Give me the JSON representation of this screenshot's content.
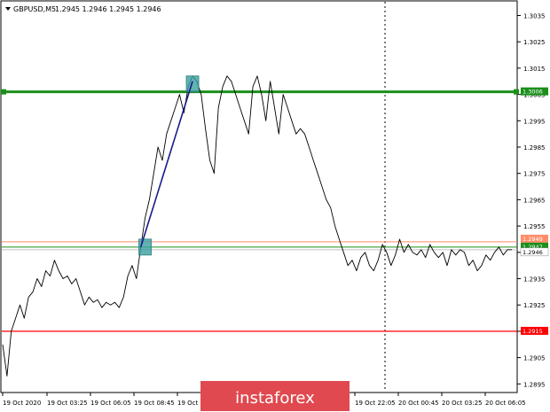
{
  "header": {
    "symbol": "GBPUSD,M5",
    "ohlc": "1.2945 1.2946 1.2945 1.2946"
  },
  "watermark": {
    "text": "instaforex",
    "color": "#e0494f"
  },
  "colors": {
    "price": "#000000",
    "trend": "#1a1a8c",
    "resistance": "#1a8f1a",
    "support": "#ff0000",
    "level_hi": "#ff8c69",
    "level_lo": "#1a8f1a",
    "marker": "#3aa0a0",
    "grid": "#000000"
  },
  "chart_data": {
    "type": "line",
    "title": "",
    "ylim": [
      1.2885,
      1.3045
    ],
    "y_ticks": [
      "1.3035",
      "1.3025",
      "1.3015",
      "1.3005",
      "1.2995",
      "1.2985",
      "1.2975",
      "1.2965",
      "1.2955",
      "1.2945",
      "1.2935",
      "1.2925",
      "1.2915",
      "1.2905",
      "1.2895"
    ],
    "x_ticks": [
      "19 Oct 2020",
      "19 Oct 03:25",
      "19 Oct 06:05",
      "19 Oct 08:45",
      "19 Oct 11:25",
      "19 Oct 22:05",
      "20 Oct 00:45",
      "20 Oct 03:25",
      "20 Oct 06:05"
    ],
    "series": [
      {
        "values": [
          1.291,
          1.2898,
          1.2915,
          1.292,
          1.2925,
          1.292,
          1.2928,
          1.293,
          1.2935,
          1.2932,
          1.2938,
          1.2936,
          1.2942,
          1.2938,
          1.2935,
          1.2936,
          1.2933,
          1.2935,
          1.293,
          1.2925,
          1.2928,
          1.2926,
          1.2927,
          1.2924,
          1.2926,
          1.2925,
          1.2926,
          1.2924,
          1.2928,
          1.2936,
          1.294,
          1.2935,
          1.2947,
          1.2958,
          1.2965,
          1.2975,
          1.2985,
          1.298,
          1.299,
          1.2995,
          1.3,
          1.3005,
          1.2998,
          1.3008,
          1.3012,
          1.301,
          1.3005,
          1.2992,
          1.298,
          1.2975,
          1.3,
          1.3008,
          1.3012,
          1.301,
          1.3005,
          1.3,
          1.2995,
          1.299,
          1.3008,
          1.3012,
          1.3005,
          1.2995,
          1.301,
          1.3,
          1.299,
          1.3005,
          1.3,
          1.2995,
          1.299,
          1.2992,
          1.299,
          1.2985,
          1.298,
          1.2975,
          1.297,
          1.2965,
          1.2962,
          1.2955,
          1.295,
          1.2945,
          1.294,
          1.2942,
          1.2938,
          1.2943,
          1.2945,
          1.294,
          1.2938,
          1.2942,
          1.2948,
          1.2945,
          1.294,
          1.2944,
          1.295,
          1.2945,
          1.2948,
          1.2945,
          1.2944,
          1.2946,
          1.2943,
          1.2948,
          1.2945,
          1.2943,
          1.2945,
          1.294,
          1.2946,
          1.2944,
          1.2946,
          1.2945,
          1.294,
          1.2942,
          1.2938,
          1.294,
          1.2944,
          1.2942,
          1.2945,
          1.2947,
          1.2944,
          1.2946,
          1.2946
        ]
      }
    ],
    "trend_line": {
      "from": {
        "i": 32,
        "value": 1.2947
      },
      "to": {
        "i": 44,
        "value": 1.301
      }
    },
    "levels": [
      {
        "value": 1.3006,
        "label": "1.3006",
        "kind": "resistance"
      },
      {
        "value": 1.2949,
        "label": "1.2949",
        "kind": "level_hi"
      },
      {
        "value": 1.2947,
        "label": "1.2947",
        "kind": "level_lo"
      },
      {
        "value": 1.2946,
        "label": "1.2946",
        "kind": "current"
      },
      {
        "value": 1.2915,
        "label": "1.2915",
        "kind": "support"
      }
    ],
    "markers": [
      {
        "i": 44,
        "value": 1.3009
      },
      {
        "i": 33,
        "value": 1.2947
      }
    ]
  }
}
